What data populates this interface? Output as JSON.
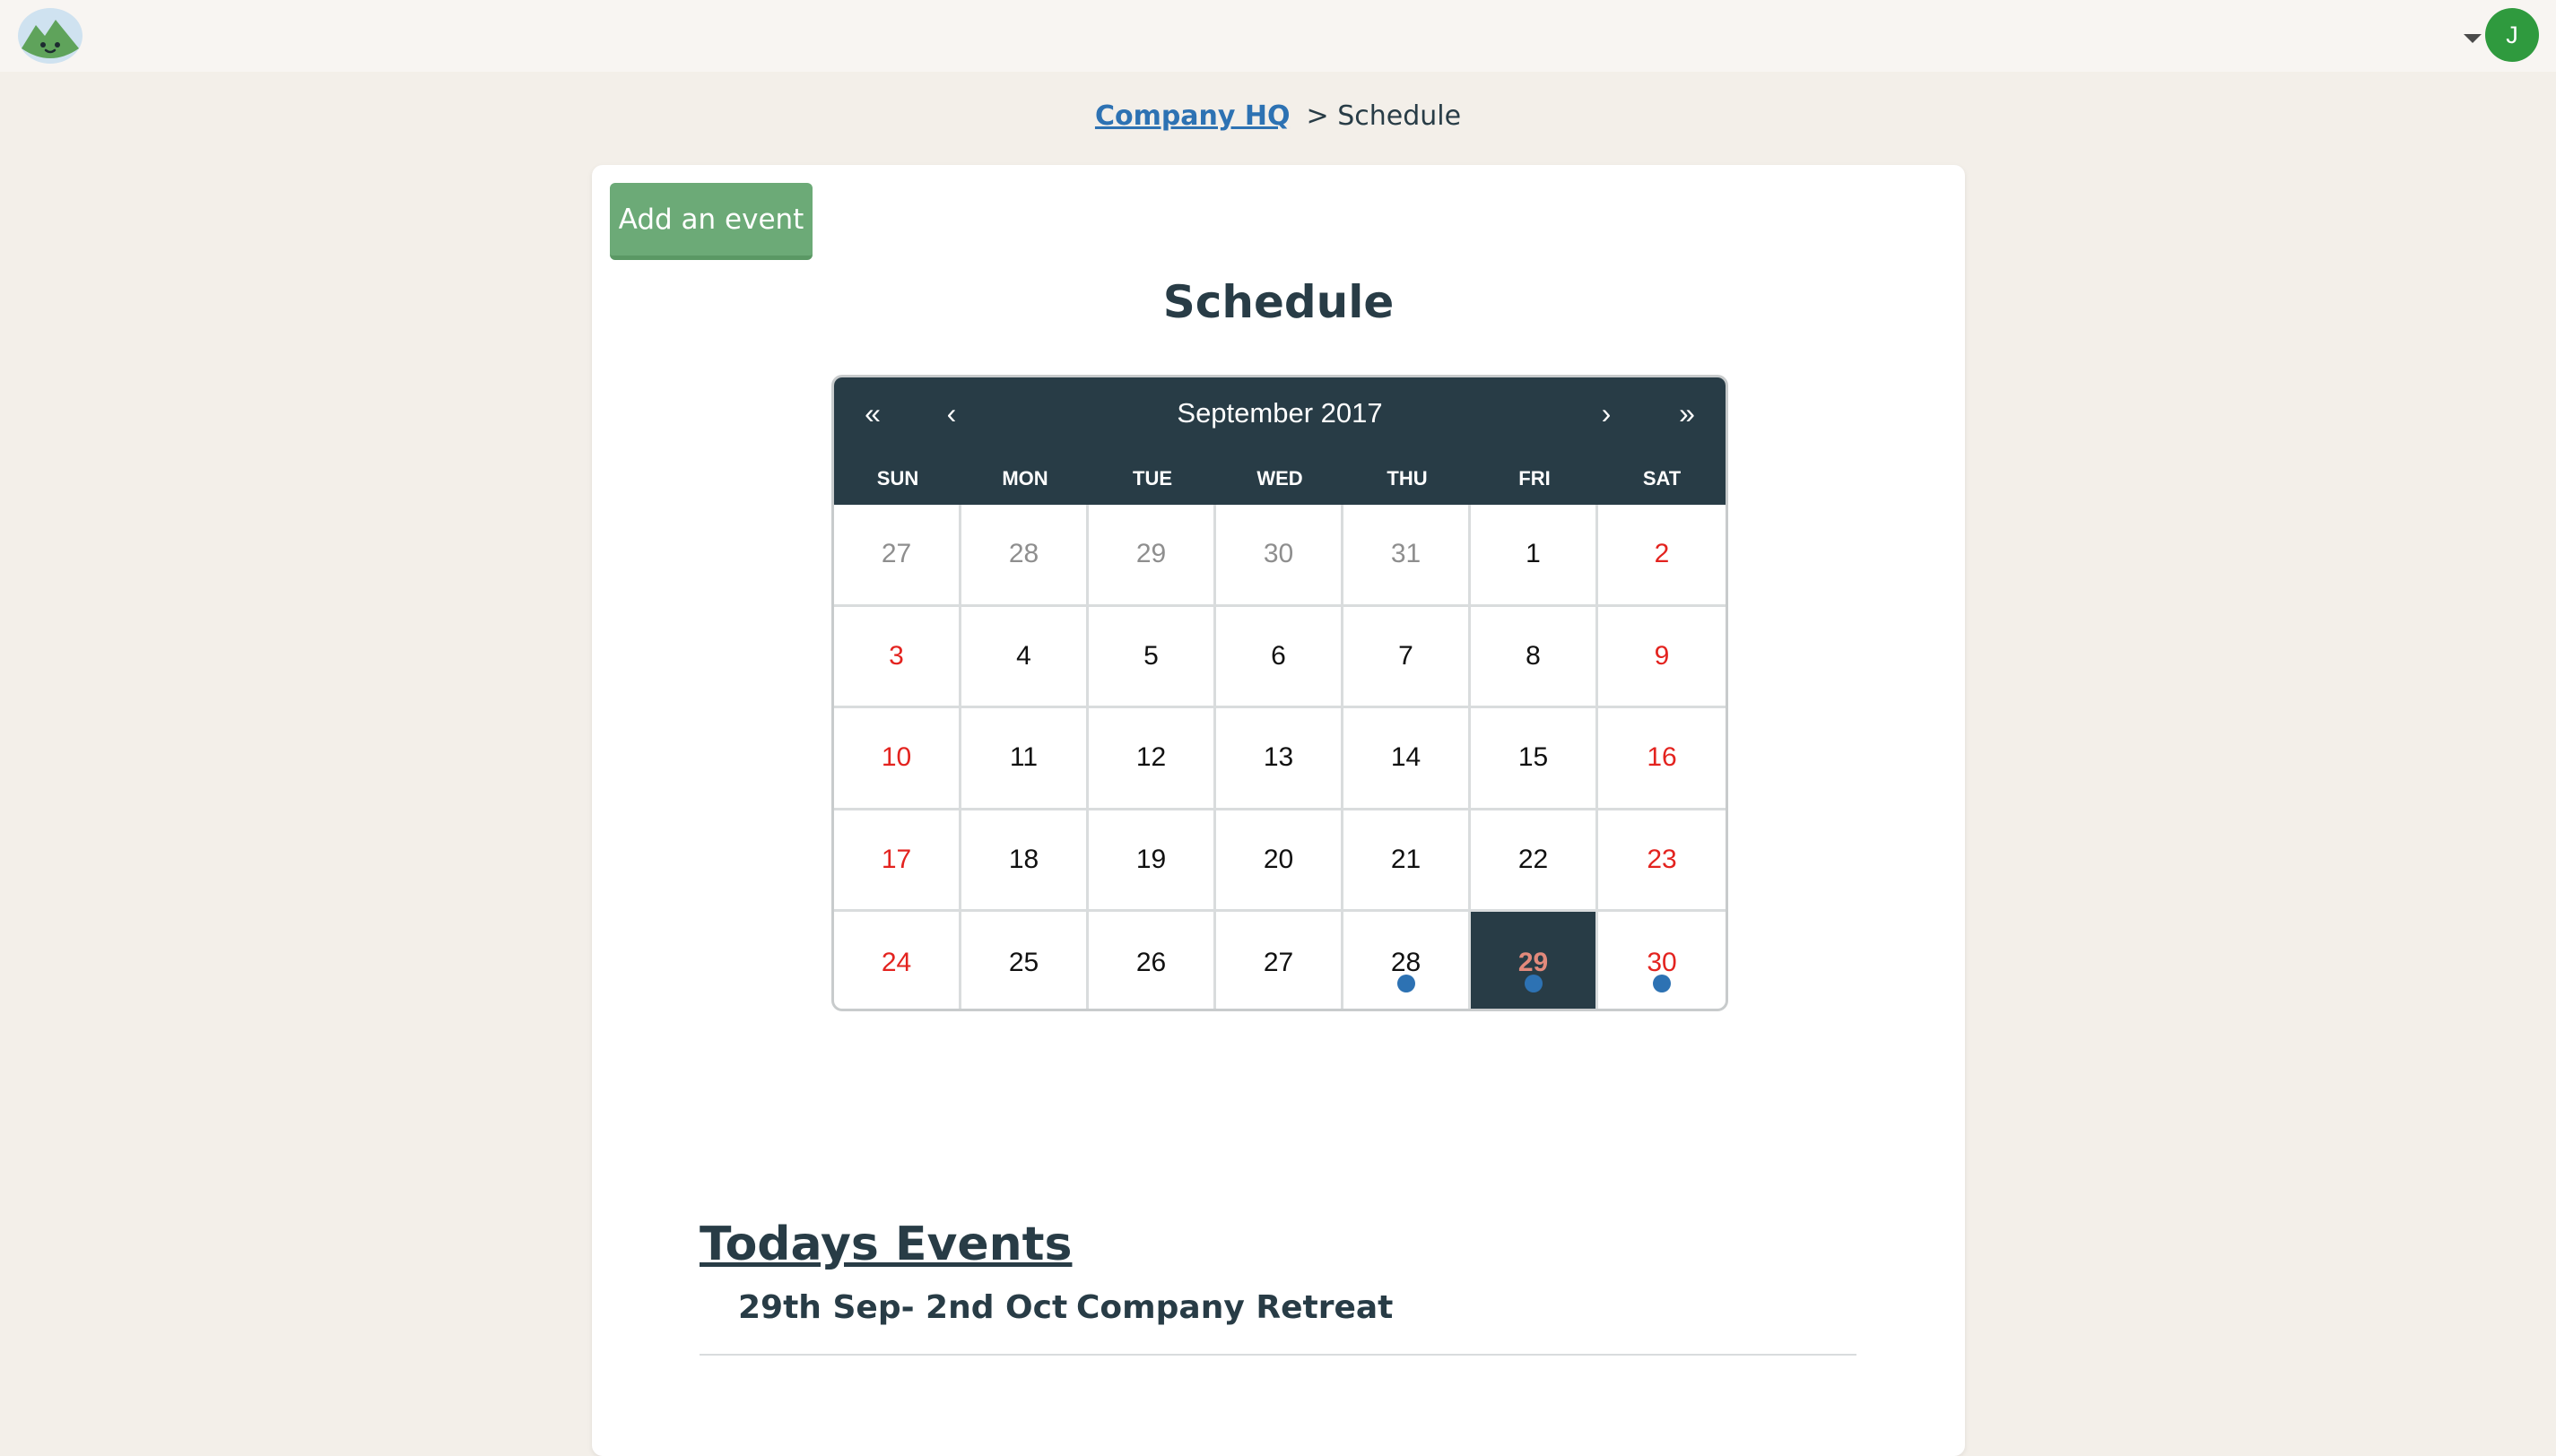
{
  "header": {
    "avatar_initial": "J"
  },
  "breadcrumb": {
    "parent_link": "Company HQ",
    "current": "> Schedule"
  },
  "toolbar": {
    "add_event_label": "Add an event"
  },
  "page_title": "Schedule",
  "calendar": {
    "prev_year": "«",
    "prev_month": "‹",
    "month_label": "September 2017",
    "next_month": "›",
    "next_year": "»",
    "weekdays": [
      "SUN",
      "MON",
      "TUE",
      "WED",
      "THU",
      "FRI",
      "SAT"
    ],
    "days": [
      {
        "label": "27",
        "other": true
      },
      {
        "label": "28",
        "other": true
      },
      {
        "label": "29",
        "other": true
      },
      {
        "label": "30",
        "other": true
      },
      {
        "label": "31",
        "other": true
      },
      {
        "label": "1"
      },
      {
        "label": "2",
        "weekend": true
      },
      {
        "label": "3",
        "weekend": true
      },
      {
        "label": "4"
      },
      {
        "label": "5"
      },
      {
        "label": "6"
      },
      {
        "label": "7"
      },
      {
        "label": "8"
      },
      {
        "label": "9",
        "weekend": true
      },
      {
        "label": "10",
        "weekend": true
      },
      {
        "label": "11"
      },
      {
        "label": "12"
      },
      {
        "label": "13"
      },
      {
        "label": "14"
      },
      {
        "label": "15"
      },
      {
        "label": "16",
        "weekend": true
      },
      {
        "label": "17",
        "weekend": true
      },
      {
        "label": "18"
      },
      {
        "label": "19"
      },
      {
        "label": "20"
      },
      {
        "label": "21"
      },
      {
        "label": "22"
      },
      {
        "label": "23",
        "weekend": true
      },
      {
        "label": "24",
        "weekend": true
      },
      {
        "label": "25"
      },
      {
        "label": "26"
      },
      {
        "label": "27"
      },
      {
        "label": "28",
        "event": true
      },
      {
        "label": "29",
        "event": true,
        "selected": true
      },
      {
        "label": "30",
        "weekend": true,
        "event": true
      }
    ]
  },
  "events": {
    "title": "Todays Events",
    "items": [
      {
        "date": "29th Sep- 2nd Oct",
        "name": "Company Retreat"
      }
    ]
  },
  "colors": {
    "accent": "#283c46",
    "link": "#2d72b3",
    "button": "#6caa77",
    "weekend": "#e3231f",
    "event_dot": "#2d72b3"
  }
}
